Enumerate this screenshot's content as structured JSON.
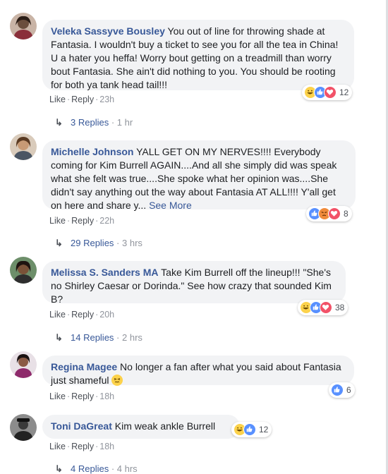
{
  "comments": [
    {
      "author": "Veleka Sassyve Bousley",
      "text": "You out of line for throwing shade at Fantasia. I wouldn't buy a ticket to see you for all the tea in China! U a hater you heffa! Worry bout getting on a treadmill than worry bout Fantasia. She ain't did nothing to you. You should be rooting for both ya tank head tail!!!",
      "like_label": "Like",
      "reply_label": "Reply",
      "time": "23h",
      "reaction_count": "12",
      "reaction_icons": [
        "haha-icon",
        "like-icon",
        "love-icon"
      ],
      "replies_label": "3 Replies",
      "replies_time": "1 hr",
      "avatar_color": "#6b4e3d"
    },
    {
      "author": "Michelle Johnson",
      "text": "YALL GET ON MY NERVES!!!! Everybody coming for Kim Burrell AGAIN....And all she simply did was speak what she felt was true....She spoke what her opinion was....She didn't say anything out the way about Fantasia AT ALL!!!! Y'all get on here and share y...",
      "see_more": "See More",
      "like_label": "Like",
      "reply_label": "Reply",
      "time": "22h",
      "reaction_count": "8",
      "reaction_icons": [
        "like-icon",
        "angry-icon",
        "love-icon"
      ],
      "replies_label": "29 Replies",
      "replies_time": "3 hrs",
      "avatar_color": "#a07a55"
    },
    {
      "author": "Melissa S. Sanders MA",
      "text": "Take Kim Burrell off the lineup!!! \"She's no Shirley Caesar or Dorinda.\" See how crazy that sounded Kim B?",
      "like_label": "Like",
      "reply_label": "Reply",
      "time": "20h",
      "reaction_count": "38",
      "reaction_icons": [
        "haha-icon",
        "like-icon",
        "love-icon"
      ],
      "replies_label": "14 Replies",
      "replies_time": "2 hrs",
      "avatar_color": "#5a4030"
    },
    {
      "author": "Regina Magee",
      "text": "No longer a fan after what you said about Fantasia just shameful",
      "like_label": "Like",
      "reply_label": "Reply",
      "time": "18h",
      "reaction_count": "6",
      "reaction_icons": [
        "like-icon"
      ],
      "avatar_color": "#7a3f5e"
    },
    {
      "author": "Toni DaGreat",
      "text": "Kim weak ankle Burrell",
      "like_label": "Like",
      "reply_label": "Reply",
      "time": "18h",
      "reaction_count": "12",
      "reaction_icons": [
        "haha-icon",
        "like-icon"
      ],
      "replies_label": "4 Replies",
      "replies_time": "4 hrs",
      "avatar_color": "#3b3b3b"
    }
  ],
  "colors": {
    "author": "#385898",
    "bubble": "#f2f3f5",
    "like": "#5890ff",
    "love": "#f25268",
    "haha": "#fcd24b",
    "angry": "#f08b3b"
  }
}
